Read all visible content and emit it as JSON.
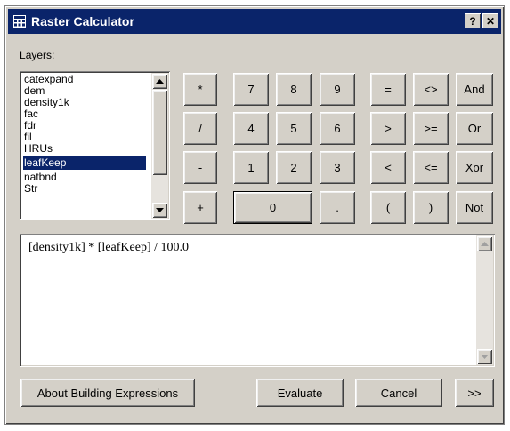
{
  "window": {
    "title": "Raster Calculator",
    "help_label": "?",
    "close_label": "✕"
  },
  "layers": {
    "label": "Layers:",
    "items": [
      "catexpand",
      "dem",
      "density1k",
      "fac",
      "fdr",
      "fil",
      "HRUs",
      "leafKeep",
      "natbnd",
      "Str"
    ],
    "selected": "leafKeep"
  },
  "keypad": {
    "ops": [
      "*",
      "/",
      "-",
      "+"
    ],
    "digits": [
      "7",
      "8",
      "9",
      "4",
      "5",
      "6",
      "1",
      "2",
      "3",
      "0",
      "."
    ],
    "compare": [
      "=",
      "<>",
      ">",
      ">=",
      "<",
      "<=",
      "(",
      ")"
    ],
    "logic": [
      "And",
      "Or",
      "Xor",
      "Not"
    ]
  },
  "expression": "[density1k] * [leafKeep] / 100.0",
  "footer": {
    "about_label": "About Building Expressions",
    "evaluate_label": "Evaluate",
    "cancel_label": "Cancel",
    "more_label": ">>"
  },
  "colors": {
    "title_bar": "#0a246a",
    "face": "#d4d0c8",
    "selection": "#0a246a"
  }
}
